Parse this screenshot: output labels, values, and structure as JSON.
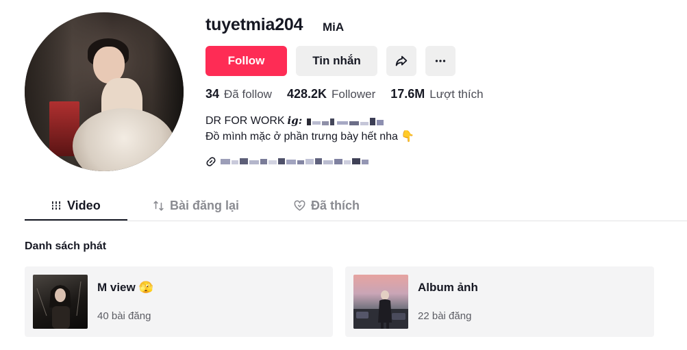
{
  "profile": {
    "username": "tuyetmia204",
    "nickname": "MiA",
    "follow_label": "Follow",
    "message_label": "Tin nhắn",
    "bio_line1": "DR FOR WORK",
    "bio_ig": "𝒊𝒈:",
    "bio_line2": "Đồ mình mặc ở phần trưng bày hết nha 👇"
  },
  "stats": [
    {
      "num": "34",
      "label": "Đã follow"
    },
    {
      "num": "428.2K",
      "label": "Follower"
    },
    {
      "num": "17.6M",
      "label": "Lượt thích"
    }
  ],
  "tabs": [
    {
      "label": "Video",
      "icon": "grid-icon"
    },
    {
      "label": "Bài đăng lại",
      "icon": "repost-icon"
    },
    {
      "label": "Đã thích",
      "icon": "heart-icon"
    }
  ],
  "playlist": {
    "section_title": "Danh sách phát",
    "items": [
      {
        "title": "M view 🫣",
        "count": "40 bài đăng"
      },
      {
        "title": "Album ảnh",
        "count": "22 bài đăng"
      }
    ]
  },
  "colors": {
    "accent": "#fe2c55",
    "button_gray": "#efefef",
    "card_bg": "#f4f4f5"
  }
}
